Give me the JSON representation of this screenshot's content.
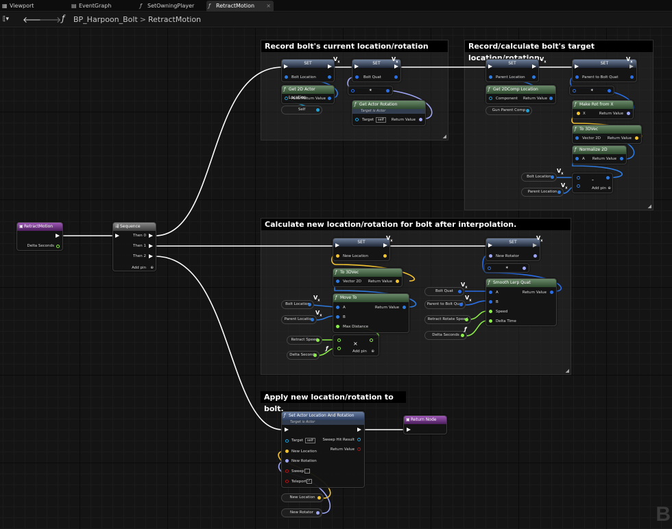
{
  "tabs": [
    {
      "label": "Viewport",
      "icon": "grid-icon"
    },
    {
      "label": "EventGraph",
      "icon": "graph-icon"
    },
    {
      "label": "SetOwningPlayer",
      "icon": "function-icon"
    },
    {
      "label": "RetractMotion",
      "icon": "function-icon"
    }
  ],
  "breadcrumb": {
    "root": "BP_Harpoon_Bolt",
    "separator": ">",
    "current": "RetractMotion"
  },
  "comments": {
    "record_current": "Record bolt's current location/rotation",
    "record_target": "Record/calculate bolt's target location/rotation.",
    "calculate_new": "Calculate new location/rotation for bolt after interpolation.",
    "apply_new": "Apply new location/rotation to bolt."
  },
  "nodes": {
    "retract_motion": {
      "title": "RetractMotion",
      "delta": "Delta Seconds"
    },
    "sequence": {
      "title": "Sequence",
      "then0": "Then 0",
      "then1": "Then 1",
      "then2": "Then 2",
      "add_pin": "Add pin"
    },
    "set1": {
      "title": "SET",
      "pin": "Bolt Location"
    },
    "set2": {
      "title": "SET",
      "pin": "Bolt Quat"
    },
    "get2d_actor": {
      "title": "Get 2D Actor Location",
      "actor": "Actor",
      "ret": "Return Value"
    },
    "self_var": "Self",
    "get_actor_rot": {
      "title": "Get Actor Rotation",
      "subtitle": "Target is Actor",
      "target": "Target",
      "self": "self",
      "ret": "Return Value"
    },
    "set3": {
      "title": "SET",
      "pin": "Parent Location"
    },
    "set4": {
      "title": "SET",
      "pin": "Parent to Bolt Quat"
    },
    "get2d_comp": {
      "title": "Get 2DComp Location",
      "component": "Component",
      "ret": "Return Value"
    },
    "gun_parent": "Gun Parent Comp",
    "make_rot": {
      "title": "Make Rot from X",
      "x": "X",
      "ret": "Return Value"
    },
    "to3dvec_top": {
      "title": "To 3DVec",
      "v2d": "Vector 2D",
      "ret": "Return Value"
    },
    "normalize": {
      "title": "Normalize 2D",
      "a": "A",
      "ret": "Return Value"
    },
    "bolt_loc_var": "Bolt Location",
    "parent_loc_var": "Parent Location",
    "minus": {
      "symbol": "-",
      "add_pin": "Add pin"
    },
    "set_newloc": {
      "title": "SET",
      "pin": "New Location"
    },
    "set_newrot": {
      "title": "SET",
      "pin": "New Rotator"
    },
    "to3dvec_mid": {
      "title": "To 3DVec",
      "v2d": "Vector 2D",
      "ret": "Return Value"
    },
    "move_to": {
      "title": "Move To",
      "a": "A",
      "b": "B",
      "maxdist": "Max Distance",
      "ret": "Return Value"
    },
    "bolt_loc2": "Bolt Location",
    "parent_loc2": "Parent Location",
    "retract_speed": "Retract Speed",
    "delta_sec": "Delta Seconds",
    "multiply": {
      "symbol": "×",
      "add_pin": "Add pin"
    },
    "bolt_quat": "Bolt Quat",
    "parent_bolt_quat": "Parent to Bolt Quat",
    "retract_rot_speed": "Retract Rotate Speed",
    "delta_sec2": "Delta Seconds",
    "smooth_lerp": {
      "title": "Smooth Lerp Quat",
      "a": "A",
      "b": "B",
      "speed": "Speed",
      "dt": "Delta Time",
      "ret": "Return Value"
    },
    "set_actor": {
      "title": "Set Actor Location And Rotation",
      "subtitle": "Target is Actor",
      "target": "Target",
      "self": "self",
      "newloc": "New Location",
      "newrot": "New Rotation",
      "sweep": "Sweep",
      "teleport": "Teleport",
      "sweep_hit": "Sweep Hit Result",
      "ret": "Return Value"
    },
    "return_node": {
      "title": "Return Node"
    },
    "new_loc_var": "New Location",
    "new_rot_var": "New Rotator"
  },
  "colors": {
    "exec": "#ffffff",
    "vector": "#f5c531",
    "vector2d": "#2e7be0",
    "struct_quat": "#2a6fe8",
    "float": "#8cee4a",
    "object": "#1ea4dd",
    "rotator": "#9fa8f7",
    "bool": "#b01515"
  },
  "watermark": "B"
}
